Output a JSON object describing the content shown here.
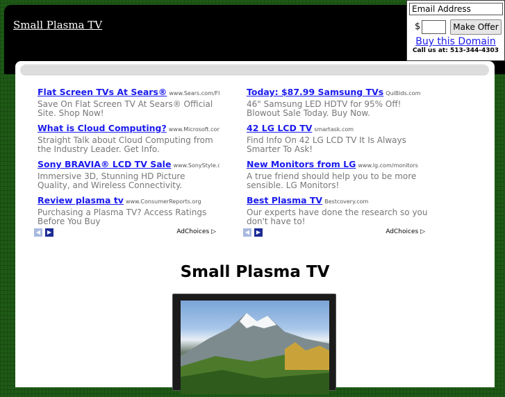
{
  "site": {
    "title": "Small Plasma TV"
  },
  "offer": {
    "email_value": "Email Address",
    "currency_symbol": "$",
    "amount_value": "",
    "button_label": "Make Offer",
    "buy_link": "Buy this Domain",
    "call_us": "Call us at: 513-344-4303"
  },
  "ads": {
    "left": [
      {
        "title": "Flat Screen TVs At Sears®",
        "url": "www.Sears.com/Fla...",
        "desc": "Save On Flat Screen TV At Sears® Official Site. Shop Now!"
      },
      {
        "title": "What is Cloud Computing?",
        "url": "www.Microsoft.com/...",
        "desc": "Straight Talk about Cloud Computing from the Industry Leader. Get Info."
      },
      {
        "title": "Sony BRAVIA® LCD TV Sale",
        "url": "www.SonyStyle.co...",
        "desc": "Immersive 3D, Stunning HD Picture Quality, and Wireless Connectivity."
      },
      {
        "title": "Review plasma tv",
        "url": "www.ConsumerReports.org",
        "desc": "Purchasing a Plasma TV? Access Ratings Before You Buy"
      }
    ],
    "right": [
      {
        "title": "Today: $87.99 Samsung TVs",
        "url": "QuiBids.com",
        "desc": "46\" Samsung LED HDTV for 95% Off! Blowout Sale Today. Buy Now."
      },
      {
        "title": "42 LG LCD TV",
        "url": "smartask.com",
        "desc": "Find Info On 42 LG LCD TV It Is Always Smarter To Ask!"
      },
      {
        "title": "New Monitors from LG",
        "url": "www.lg.com/monitors",
        "desc": "A true friend should help you to be more sensible. LG Monitors!"
      },
      {
        "title": "Best Plasma TV",
        "url": "Bestcovery.com",
        "desc": "Our experts have done the research so you don't have to!"
      }
    ],
    "adchoices_label": "AdChoices"
  },
  "main": {
    "headline": "Small Plasma TV"
  },
  "icons": {
    "prev": "chevron-left-icon",
    "next": "chevron-right-icon",
    "adchoices": "adchoices-triangle-icon"
  }
}
